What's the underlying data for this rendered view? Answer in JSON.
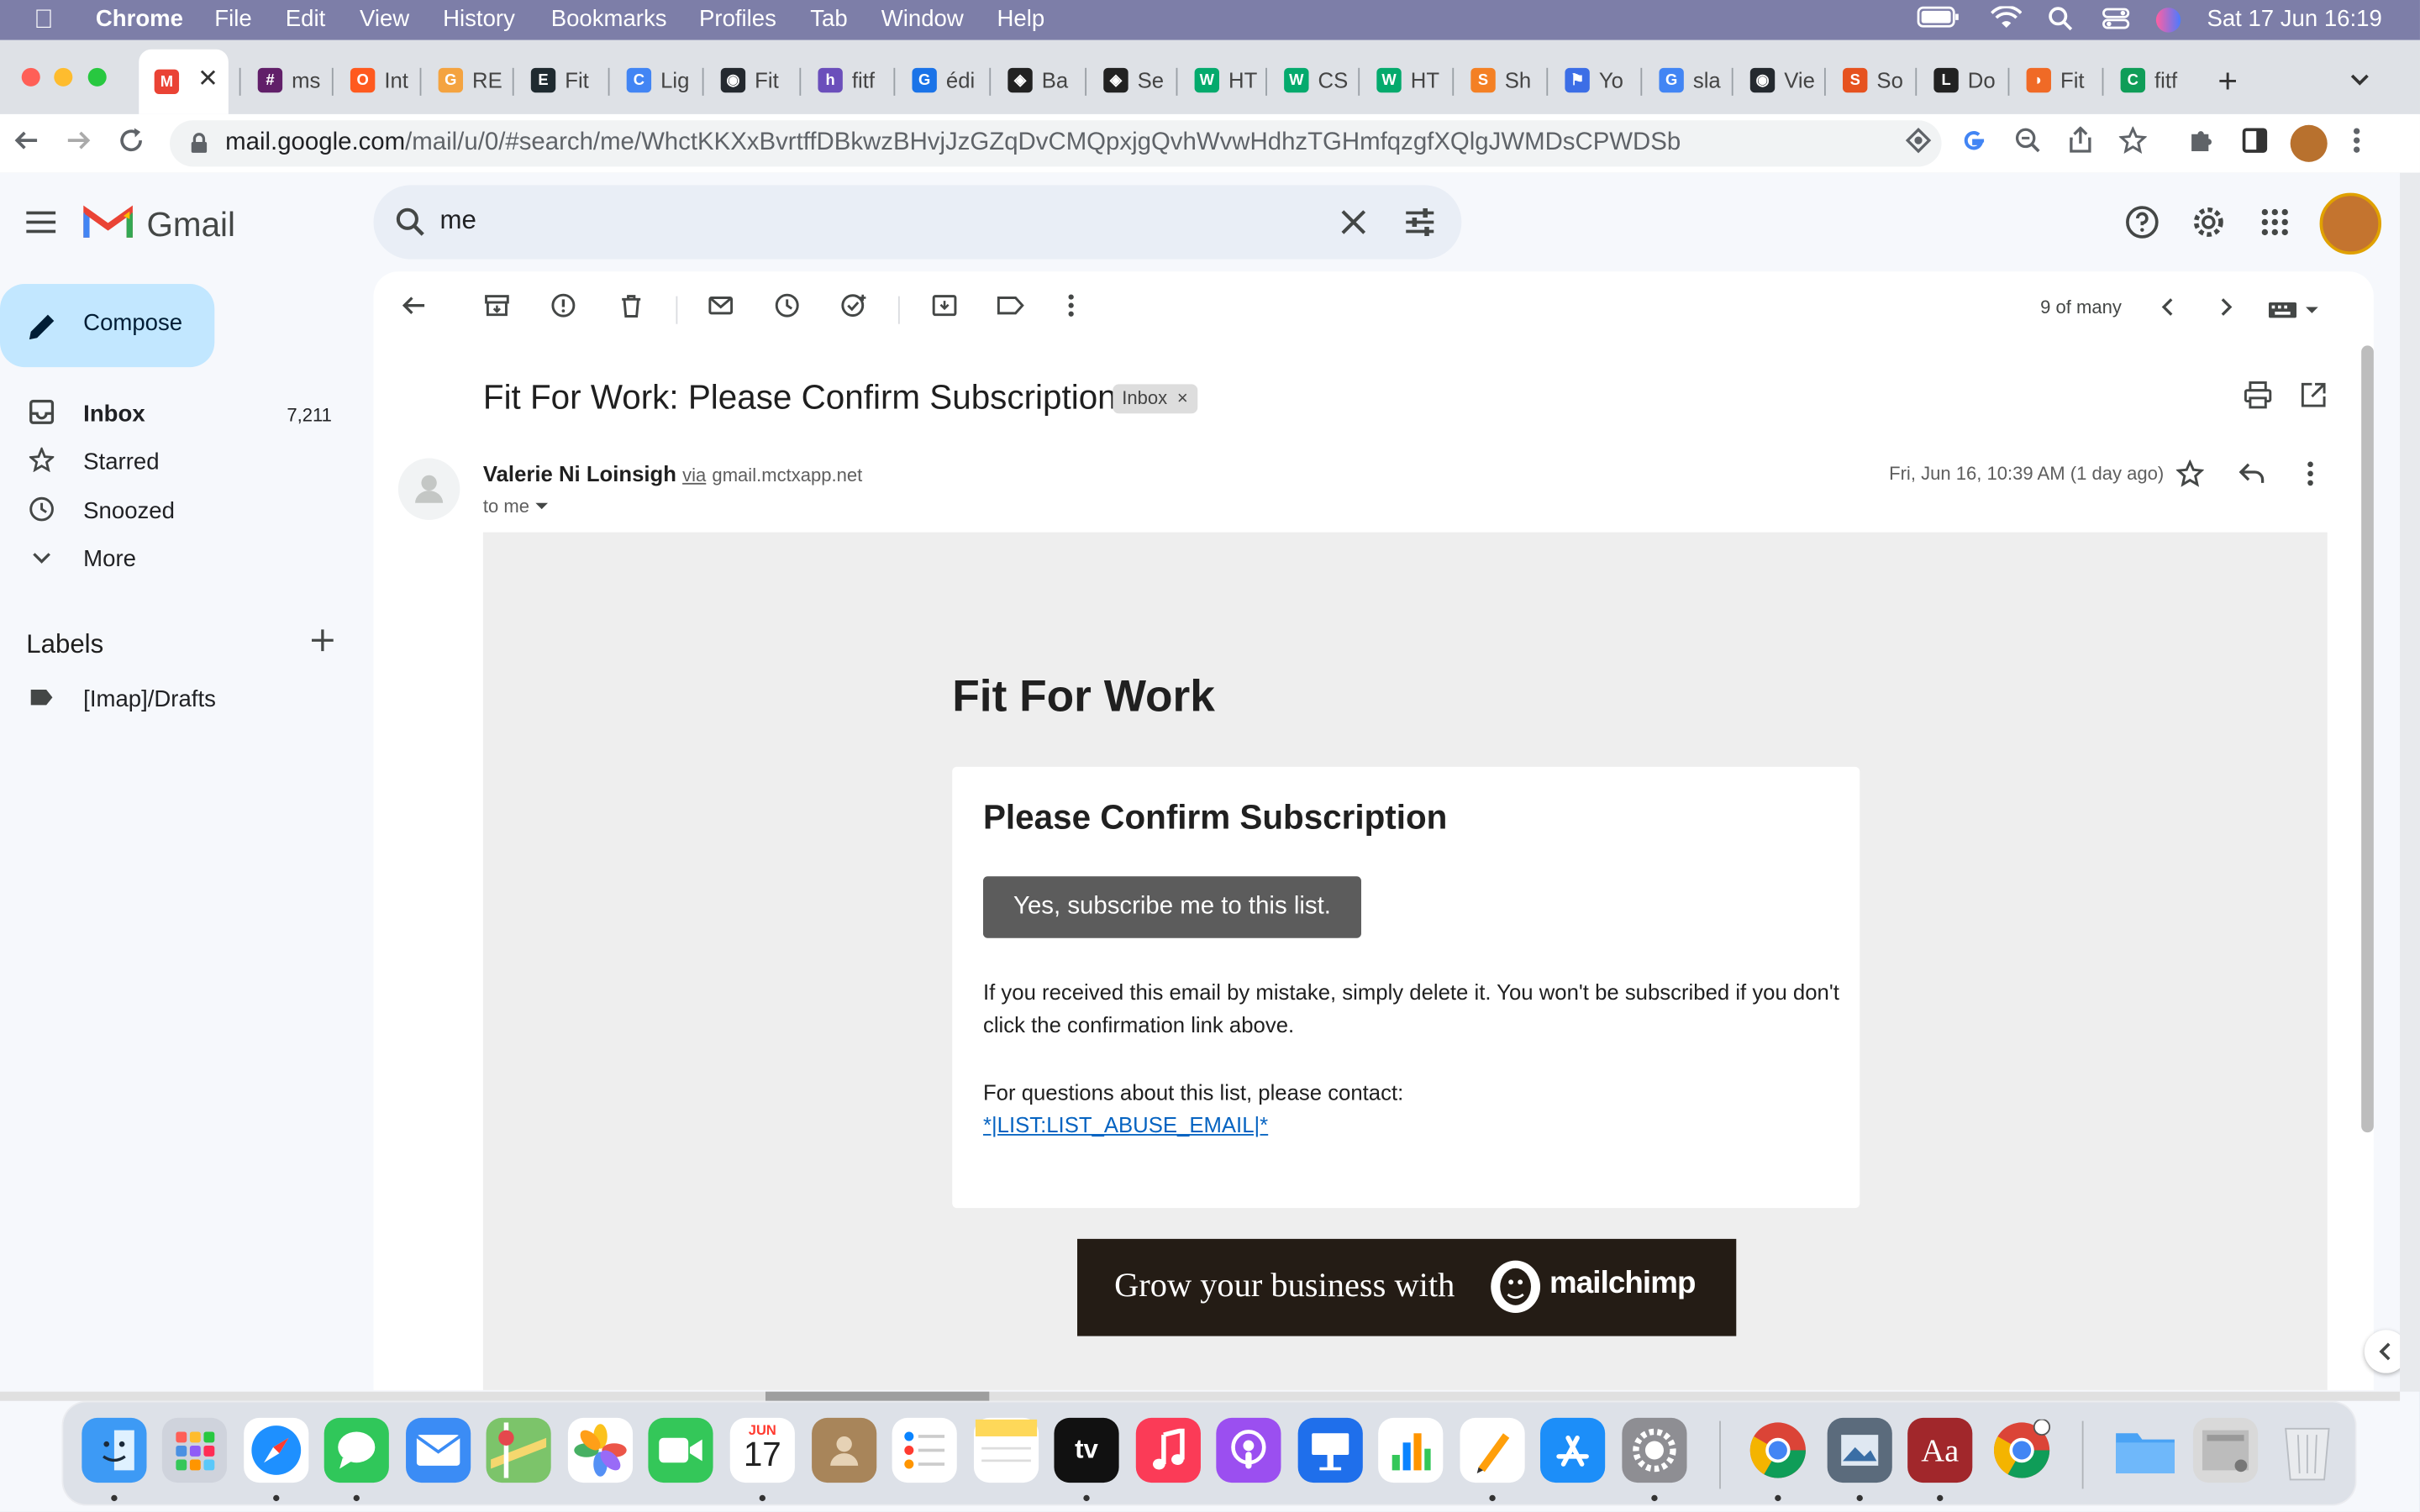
{
  "menubar": {
    "app": "Chrome",
    "items": [
      "File",
      "Edit",
      "View",
      "History",
      "Bookmarks",
      "Profiles",
      "Tab",
      "Window",
      "Help"
    ],
    "clock": "Sat 17 Jun  16:19"
  },
  "tabs": [
    {
      "label": "",
      "color": "#ea4335",
      "glyph": "M"
    },
    {
      "label": "ms",
      "color": "#611f69",
      "glyph": "#"
    },
    {
      "label": "Int",
      "color": "#ff5a1f",
      "glyph": "O"
    },
    {
      "label": "RE",
      "color": "#f4a340",
      "glyph": "G"
    },
    {
      "label": "Fit",
      "color": "#1f2a30",
      "glyph": "E"
    },
    {
      "label": "Lig",
      "color": "#4285f4",
      "glyph": "C"
    },
    {
      "label": "Fit",
      "color": "#24292f",
      "glyph": "◉"
    },
    {
      "label": "fitf",
      "color": "#6b4fbb",
      "glyph": "h"
    },
    {
      "label": "édi",
      "color": "#1a73e8",
      "glyph": "G"
    },
    {
      "label": "Ba",
      "color": "#222",
      "glyph": "◈"
    },
    {
      "label": "Se",
      "color": "#222",
      "glyph": "◈"
    },
    {
      "label": "HT",
      "color": "#04aa6d",
      "glyph": "W"
    },
    {
      "label": "CS",
      "color": "#04aa6d",
      "glyph": "W"
    },
    {
      "label": "HT",
      "color": "#04aa6d",
      "glyph": "W"
    },
    {
      "label": "Sh",
      "color": "#f48024",
      "glyph": "S"
    },
    {
      "label": "Yo",
      "color": "#3c6ee6",
      "glyph": "⚑"
    },
    {
      "label": "sla",
      "color": "#4285f4",
      "glyph": "G"
    },
    {
      "label": "Vie",
      "color": "#24292f",
      "glyph": "◉"
    },
    {
      "label": "So",
      "color": "#e6521f",
      "glyph": "S"
    },
    {
      "label": "Do",
      "color": "#222",
      "glyph": "L"
    },
    {
      "label": "Fit",
      "color": "#f06a26",
      "glyph": "◗"
    },
    {
      "label": "fitf",
      "color": "#0f9d58",
      "glyph": "C"
    }
  ],
  "address": {
    "host": "mail.google.com",
    "path": "/mail/u/0/#search/me/WhctKKXxBvrtffDBkwzBHvjJzGZqDvCMQpxjgQvhWvwHdhzTGHmfqzgfXQlgJWMDsCPWDSb"
  },
  "gmail": {
    "brand": "Gmail",
    "search_query": "me",
    "compose": "Compose",
    "nav": [
      {
        "label": "Inbox",
        "count": "7,211"
      },
      {
        "label": "Starred",
        "count": ""
      },
      {
        "label": "Snoozed",
        "count": ""
      },
      {
        "label": "More",
        "count": ""
      }
    ],
    "labels_heading": "Labels",
    "labels": [
      "[Imap]/Drafts"
    ],
    "pager": "9 of many"
  },
  "message": {
    "subject": "Fit For Work: Please Confirm Subscription",
    "badge": "Inbox",
    "sender_name": "Valerie Ni Loinsigh",
    "via": "via",
    "via_domain": "gmail.mctxapp.net",
    "to": "to me",
    "date": "Fri, Jun 16, 10:39 AM (1 day ago)"
  },
  "email": {
    "brand_title": "Fit For Work",
    "card_title": "Please Confirm Subscription",
    "button": "Yes, subscribe me to this list.",
    "para1": "If you received this email by mistake, simply delete it. You won't be subscribed if you don't click the confirmation link above.",
    "para2": "For questions about this list, please contact:",
    "link": "*|LIST:LIST_ABUSE_EMAIL|*",
    "banner_text": "Grow your business with",
    "banner_brand": "mailchimp"
  },
  "dock": {
    "calendar_month": "JUN",
    "calendar_day": "17",
    "appletv": "tv",
    "dictionary": "Aa"
  }
}
